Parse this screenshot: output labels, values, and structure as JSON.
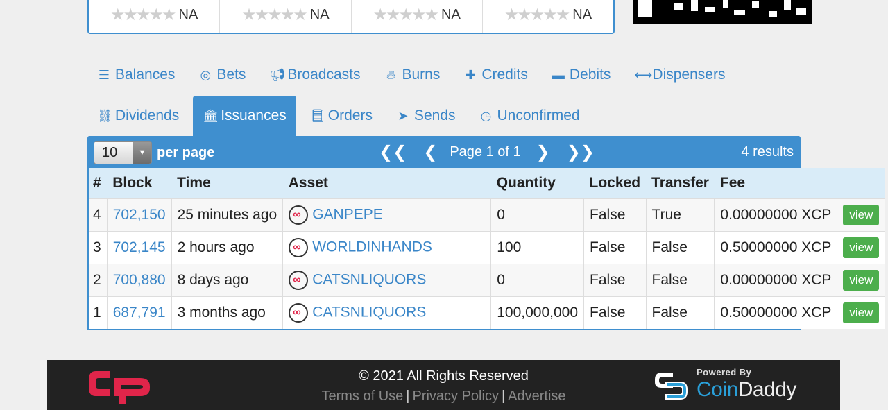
{
  "ratings": [
    {
      "label": "NA"
    },
    {
      "label": "NA"
    },
    {
      "label": "NA"
    },
    {
      "label": "NA"
    }
  ],
  "tabs_row1": [
    {
      "label": "Balances",
      "icon": "list-icon"
    },
    {
      "label": "Bets",
      "icon": "target-icon"
    },
    {
      "label": "Broadcasts",
      "icon": "bullhorn-icon"
    },
    {
      "label": "Burns",
      "icon": "fire-icon"
    },
    {
      "label": "Credits",
      "icon": "plus-icon"
    },
    {
      "label": "Debits",
      "icon": "minus-icon"
    },
    {
      "label": "Dispensers",
      "icon": "arrows-h-icon"
    }
  ],
  "tabs_row2": [
    {
      "label": "Dividends",
      "icon": "sitemap-icon"
    },
    {
      "label": "Issuances",
      "icon": "bank-icon",
      "active": true
    },
    {
      "label": "Orders",
      "icon": "book-icon"
    },
    {
      "label": "Sends",
      "icon": "send-icon"
    },
    {
      "label": "Unconfirmed",
      "icon": "clock-icon"
    }
  ],
  "pager": {
    "per_page_value": "10",
    "per_page_label": "per page",
    "page_text": "Page 1 of 1",
    "results_text": "4 results"
  },
  "table": {
    "headers": [
      "#",
      "Block",
      "Time",
      "Asset",
      "Quantity",
      "Locked",
      "Transfer",
      "Fee",
      ""
    ],
    "rows": [
      {
        "n": "4",
        "block": "702,150",
        "time": "25 minutes ago",
        "asset": "GANPEPE",
        "quantity": "0",
        "locked": "False",
        "transfer": "True",
        "fee": "0.00000000 XCP",
        "action": "view"
      },
      {
        "n": "3",
        "block": "702,145",
        "time": "2 hours ago",
        "asset": "WORLDINHANDS",
        "quantity": "100",
        "locked": "False",
        "transfer": "False",
        "fee": "0.50000000 XCP",
        "action": "view"
      },
      {
        "n": "2",
        "block": "700,880",
        "time": "8 days ago",
        "asset": "CATSNLIQUORS",
        "quantity": "0",
        "locked": "False",
        "transfer": "False",
        "fee": "0.00000000 XCP",
        "action": "view"
      },
      {
        "n": "1",
        "block": "687,791",
        "time": "3 months ago",
        "asset": "CATSNLIQUORS",
        "quantity": "100,000,000",
        "locked": "False",
        "transfer": "False",
        "fee": "0.50000000 XCP",
        "action": "view"
      }
    ]
  },
  "footer": {
    "copyright": "© 2021 All Rights Reserved",
    "links": [
      "Terms of Use",
      "Privacy Policy",
      "Advertise"
    ],
    "powered_by": "Powered By",
    "brand_a": "Coin",
    "brand_b": "Daddy"
  },
  "colors": {
    "accent": "#3f8fcf",
    "link": "#3a86c8",
    "view": "#4cae4c",
    "logo": "#e0254a"
  }
}
